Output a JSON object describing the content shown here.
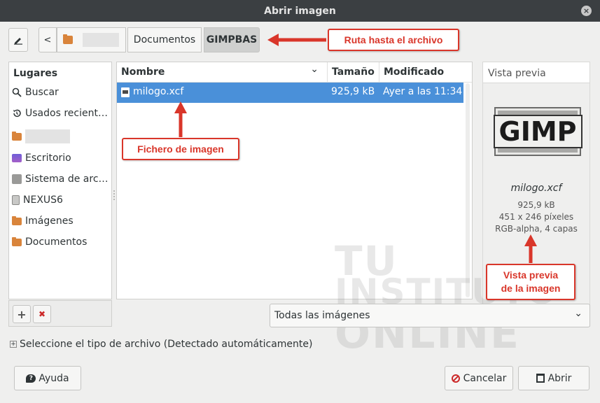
{
  "window": {
    "title": "Abrir imagen",
    "close_glyph": "×"
  },
  "pathbar": {
    "crumbs": [
      "Documentos",
      "GIMPBAS"
    ],
    "back_glyph": "<"
  },
  "places": {
    "title": "Lugares",
    "items": [
      "Buscar",
      "Usados recient…",
      "Escritorio",
      "Sistema de arc…",
      "NEXUS6",
      "Imágenes",
      "Documentos"
    ],
    "add_glyph": "+",
    "remove_glyph": "✖"
  },
  "files": {
    "columns": [
      "Nombre",
      "Tamaño",
      "Modificado"
    ],
    "sort_glyph": "⌄",
    "rows": [
      {
        "name": "milogo.xcf",
        "size": "925,9 kB",
        "modified": "Ayer a las 11:34"
      }
    ]
  },
  "filter": {
    "selected": "Todas las imágenes",
    "chevron": "⌄"
  },
  "preview": {
    "title": "Vista previa",
    "logo_text": "GIMP",
    "filename": "milogo.xcf",
    "size": "925,9 kB",
    "dimensions": "451 x 246 píxeles",
    "info": "RGB-alpha, 4 capas"
  },
  "filetype": {
    "expander": "+",
    "label": "Seleccione el tipo de archivo (Detectado automáticamente)"
  },
  "buttons": {
    "help": "Ayuda",
    "cancel": "Cancelar",
    "open": "Abrir"
  },
  "annotations": {
    "path": "Ruta hasta el archivo",
    "file": "Fichero de imagen",
    "preview_line1": "Vista previa",
    "preview_line2": "de la imagen"
  },
  "watermark": {
    "line1": "TU",
    "line2": "INSTITUTO",
    "line3": "ONLINE"
  },
  "colors": {
    "selection": "#4a90d9",
    "callout": "#d9362a",
    "titlebar": "#3b3f42"
  }
}
